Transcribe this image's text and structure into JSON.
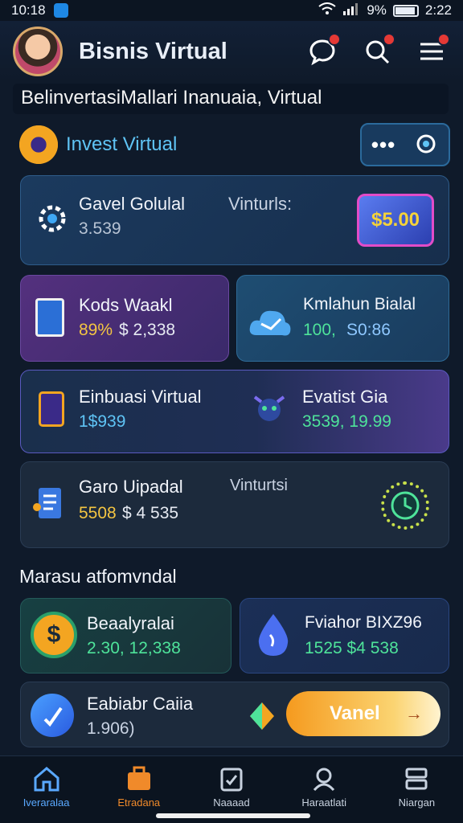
{
  "status_bar": {
    "time_left": "10:18",
    "battery_pct": "9%",
    "time_right": "2:22"
  },
  "header": {
    "title": "Bisnis Virtual"
  },
  "banner": {
    "text": "BelinvertasiMallari Inanuaia, Virtual"
  },
  "invest": {
    "label": "Invest Virtual",
    "more_label": "•••"
  },
  "cards": [
    {
      "title": "Gavel Golulal",
      "value": "3.539",
      "side_label": "Vinturls:",
      "badge": "$5.00"
    },
    {
      "title": "Kods Waakl",
      "value_a": "89%",
      "value_b": "$ 2,338"
    },
    {
      "title": "Kmlahun Bialal",
      "value_a": "100,",
      "value_b": "S0:86"
    },
    {
      "title": "Einbuasi Virtual",
      "value": "1$939",
      "title2": "Evatist Gia",
      "value2": "3539, 19.99"
    },
    {
      "title": "Garo Uipadal",
      "value_a": "5508",
      "value_b": "$ 4 535",
      "side_label": "Vinturtsi"
    }
  ],
  "section": {
    "title": "Marasu atfomvndal"
  },
  "market": [
    {
      "title": "Beaalyralai",
      "value": "2.30, 12,338"
    },
    {
      "title": "Fviahor BIXZ96",
      "value": "1525 $4 538"
    }
  ],
  "promo": {
    "title": "Eabiabr Caiia",
    "value": "1.906)",
    "cta_label": "Vanel",
    "cta_arrow": "→"
  },
  "nav": [
    {
      "label": "Iveraralaa"
    },
    {
      "label": "Etradana"
    },
    {
      "label": "Naaaad"
    },
    {
      "label": "Haraatlati"
    },
    {
      "label": "Niargan"
    }
  ],
  "colors": {
    "accent_blue": "#5fc4f5",
    "gold": "#f4c542",
    "orange": "#f59a1e",
    "green": "#4ee39a",
    "notify_red": "#e53935"
  }
}
